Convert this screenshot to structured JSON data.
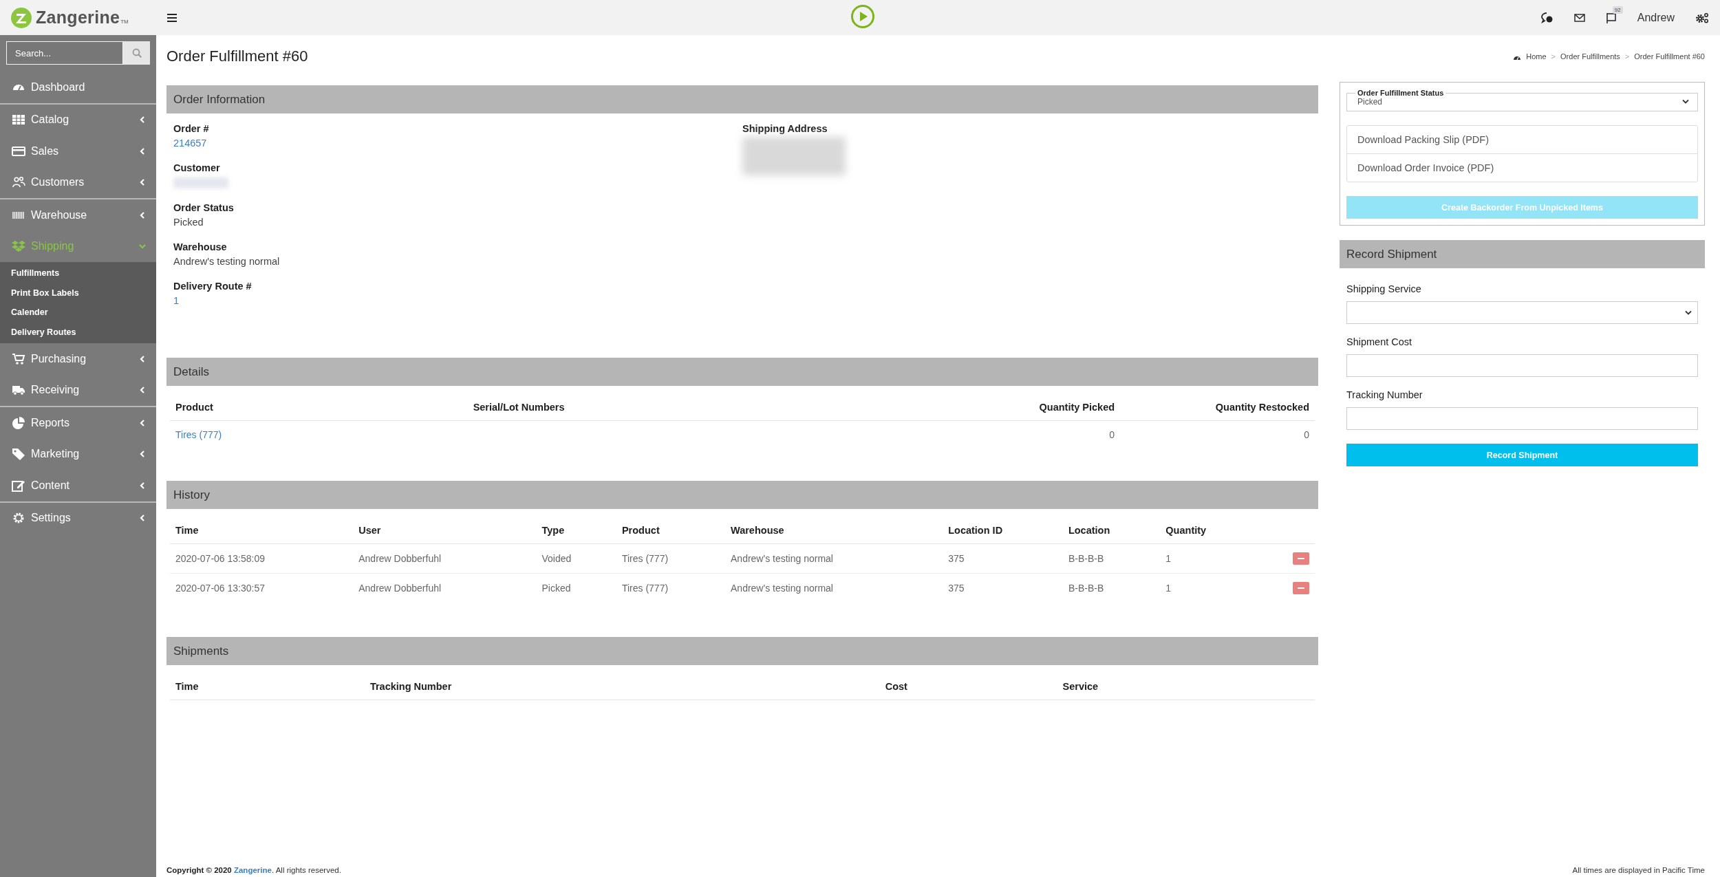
{
  "topbar": {
    "logo": {
      "name": "Zangerine",
      "mark": "TM"
    },
    "notification_count": "92",
    "user": "Andrew"
  },
  "sidebar": {
    "search": {
      "placeholder": "Search..."
    },
    "sections": [
      [
        {
          "label": "Dashboard",
          "kind": "link",
          "selected": false
        }
      ],
      [
        {
          "label": "Catalog",
          "kind": "group",
          "selected": false,
          "expanded": false
        },
        {
          "label": "Sales",
          "kind": "group",
          "selected": false,
          "expanded": false
        },
        {
          "label": "Customers",
          "kind": "group",
          "selected": false,
          "expanded": false
        }
      ],
      [
        {
          "label": "Warehouse",
          "kind": "group",
          "selected": false,
          "expanded": false
        },
        {
          "label": "Shipping",
          "kind": "group",
          "selected": true,
          "expanded": true,
          "children": [
            {
              "label": "Fulfillments"
            },
            {
              "label": "Print Box Labels"
            },
            {
              "label": "Calender"
            },
            {
              "label": "Delivery Routes"
            }
          ]
        },
        {
          "label": "Purchasing",
          "kind": "group",
          "selected": false,
          "expanded": false
        },
        {
          "label": "Receiving",
          "kind": "group",
          "selected": false,
          "expanded": false
        }
      ],
      [
        {
          "label": "Reports",
          "kind": "group",
          "selected": false,
          "expanded": false
        },
        {
          "label": "Marketing",
          "kind": "group",
          "selected": false,
          "expanded": false
        },
        {
          "label": "Content",
          "kind": "group",
          "selected": false,
          "expanded": false
        }
      ],
      [
        {
          "label": "Settings",
          "kind": "group",
          "selected": false,
          "expanded": false
        }
      ]
    ]
  },
  "page": {
    "title": "Order Fulfillment #60",
    "breadcrumb": {
      "separator": ">",
      "items": [
        "Home",
        "Order Fulfillments",
        "Order Fulfillment #60"
      ]
    }
  },
  "order_information": {
    "title": "Order Information",
    "left_fields": [
      {
        "label": "Order #",
        "value": "214657",
        "kind": "link"
      },
      {
        "label": "Customer",
        "kind": "blurred"
      },
      {
        "label": "Order Status",
        "value": "Picked",
        "kind": "text"
      },
      {
        "label": "Warehouse",
        "value": "Andrew's testing normal",
        "kind": "text"
      },
      {
        "label": "Delivery Route #",
        "value": "1",
        "kind": "link"
      }
    ],
    "right_fields": [
      {
        "label": "Shipping Address",
        "kind": "blurred"
      }
    ]
  },
  "details": {
    "title": "Details",
    "columns": [
      "Product",
      "Serial/Lot Numbers",
      "Quantity Picked",
      "Quantity Restocked"
    ],
    "rows": [
      [
        "Tires (777)",
        "",
        "0",
        "0"
      ]
    ]
  },
  "history": {
    "title": "History",
    "columns": [
      "Time",
      "User",
      "Type",
      "Product",
      "Warehouse",
      "Location ID",
      "Location",
      "Quantity"
    ],
    "rows": [
      [
        "2020-07-06 13:58:09",
        "Andrew Dobberfuhl",
        "Voided",
        "Tires (777)",
        "Andrew's testing normal",
        "375",
        "B-B-B-B",
        "1"
      ],
      [
        "2020-07-06 13:30:57",
        "Andrew Dobberfuhl",
        "Picked",
        "Tires (777)",
        "Andrew's testing normal",
        "375",
        "B-B-B-B",
        "1"
      ]
    ]
  },
  "shipments": {
    "title": "Shipments",
    "columns": [
      "Time",
      "Tracking Number",
      "Cost",
      "Service"
    ]
  },
  "status_panel": {
    "status_select": {
      "legend": "Order Fulfillment Status",
      "value": "Picked"
    },
    "downloads": [
      "Download Packing Slip (PDF)",
      "Download Order Invoice (PDF)"
    ],
    "backorder_button": {
      "label": "Create Backorder From Unpicked Items",
      "disabled": true
    }
  },
  "record_shipment": {
    "title": "Record Shipment",
    "fields": [
      {
        "label": "Shipping Service",
        "kind": "select"
      },
      {
        "label": "Shipment Cost",
        "kind": "input"
      },
      {
        "label": "Tracking Number",
        "kind": "input"
      }
    ],
    "button": "Record Shipment"
  },
  "footer": {
    "copyright": "Copyright © 2020",
    "link": "Zangerine",
    "rights": ". All rights reserved.",
    "timezone_note": "All times are displayed in Pacific Time"
  }
}
